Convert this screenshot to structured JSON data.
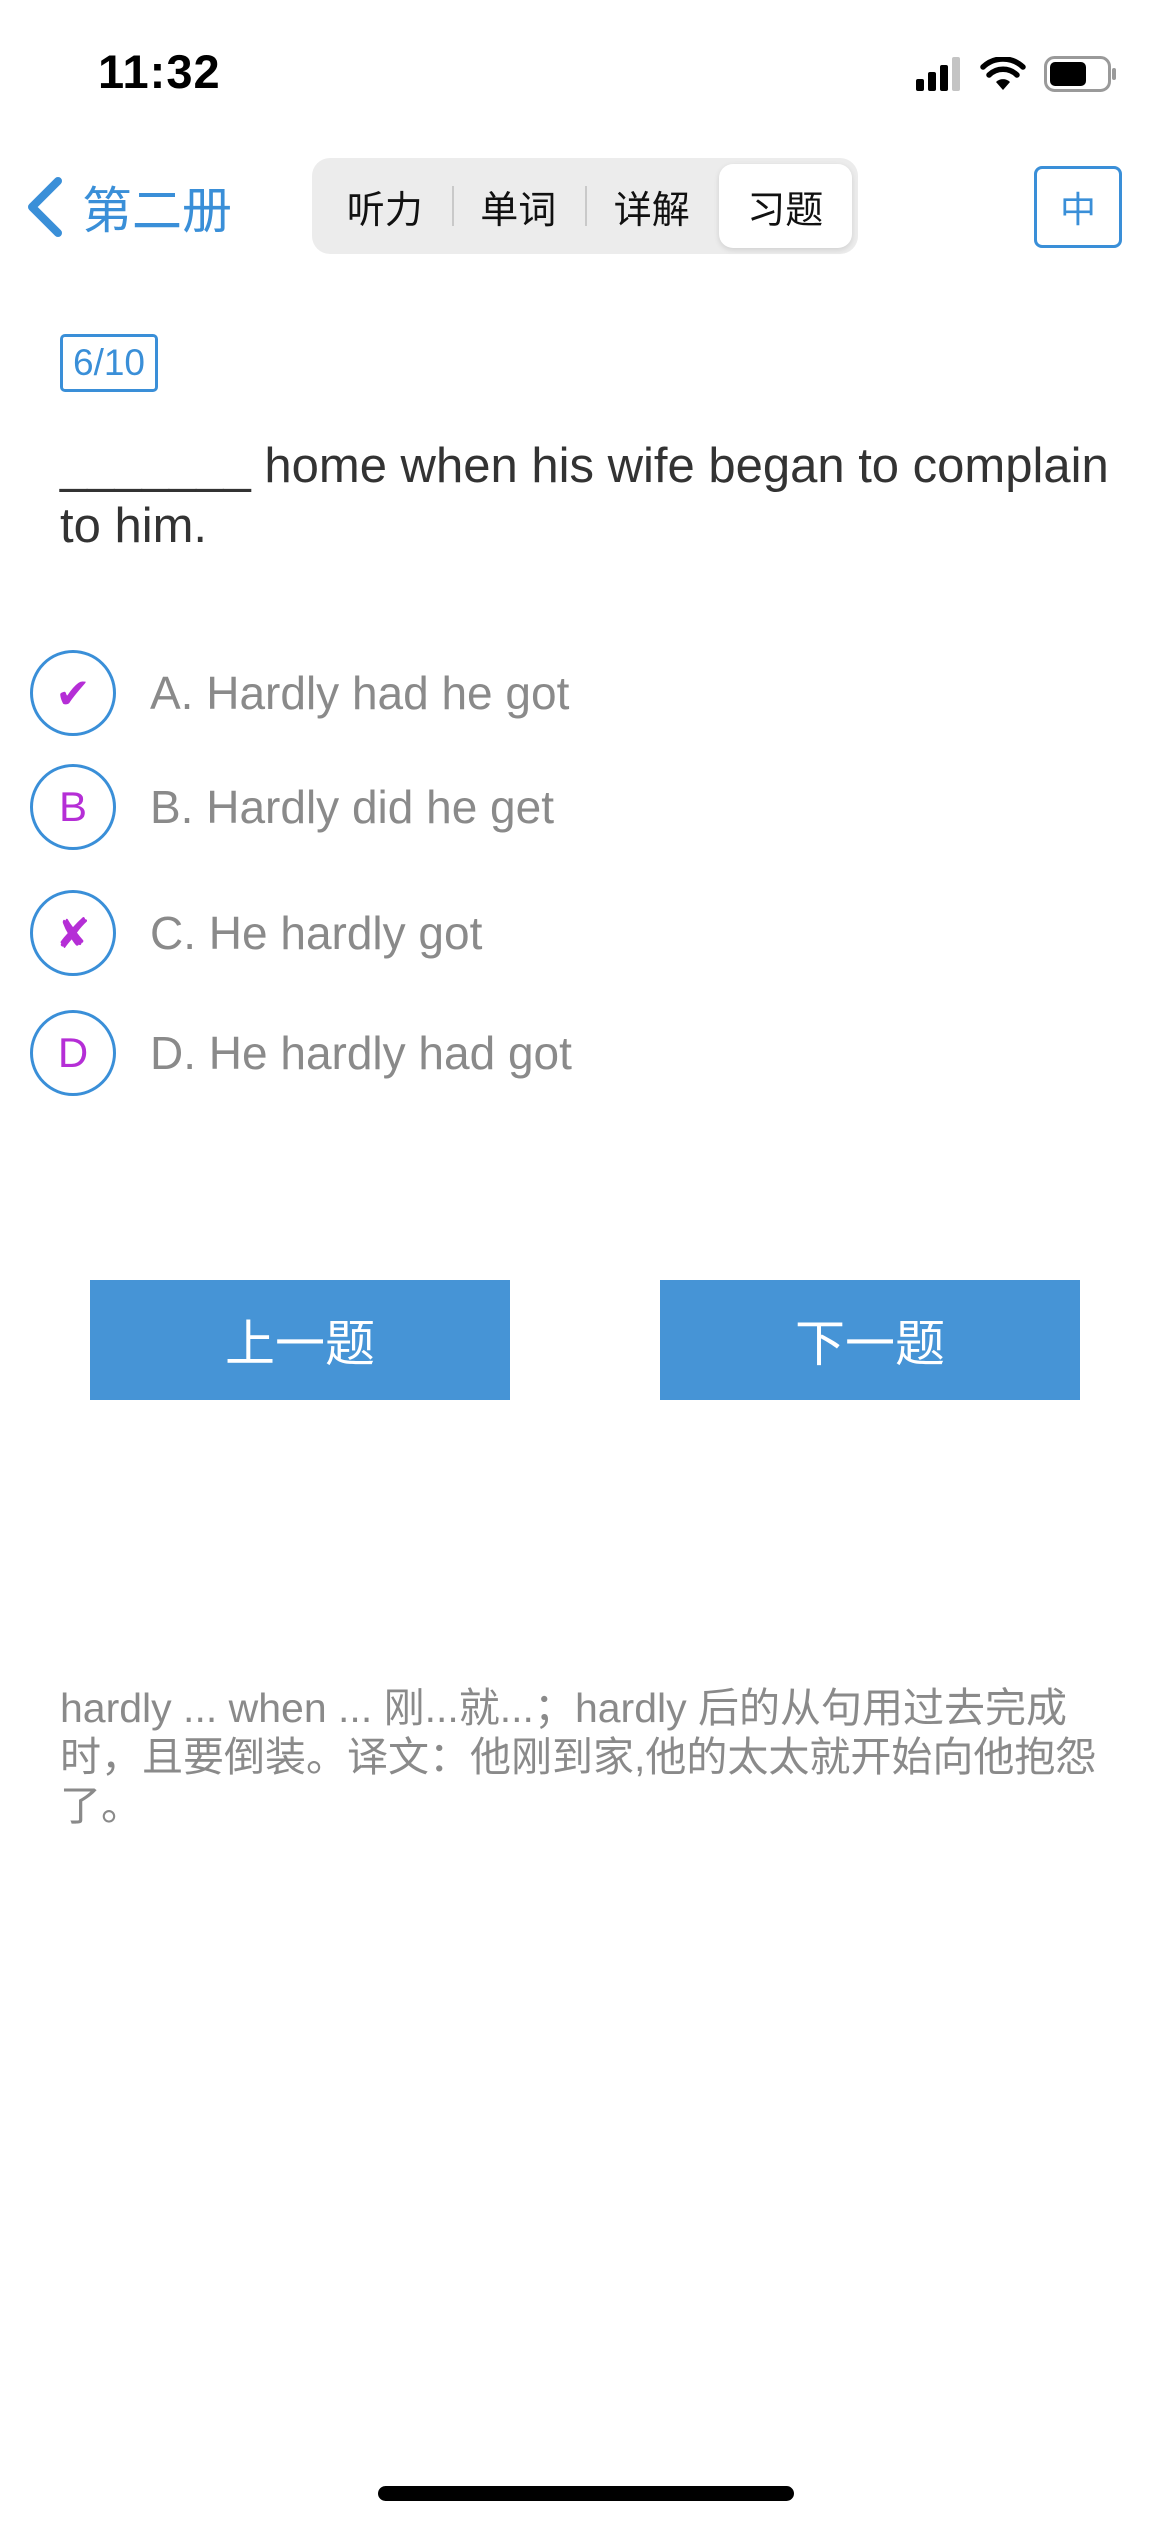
{
  "status_bar": {
    "time": "11:32",
    "icons": [
      "signal-icon",
      "wifi-icon",
      "battery-icon"
    ]
  },
  "nav": {
    "back_label": "第二册",
    "tabs": [
      {
        "label": "听力",
        "active": false
      },
      {
        "label": "单词",
        "active": false
      },
      {
        "label": "详解",
        "active": false
      },
      {
        "label": "习题",
        "active": true
      }
    ],
    "lang_button": "中"
  },
  "question": {
    "progress": "6/10",
    "text": "_______ home when his wife began to complain to him.",
    "options": [
      {
        "marker": "✔",
        "marker_icon": "check-icon",
        "text": "A. Hardly had he got",
        "state": "correct"
      },
      {
        "marker": "B",
        "marker_icon": "letter",
        "text": "B. Hardly did he get",
        "state": "none"
      },
      {
        "marker": "✘",
        "marker_icon": "cross-icon",
        "text": "C. He hardly got",
        "state": "wrong"
      },
      {
        "marker": "D",
        "marker_icon": "letter",
        "text": "D. He hardly had got",
        "state": "none"
      }
    ]
  },
  "buttons": {
    "prev": "上一题",
    "next": "下一题"
  },
  "explanation": "hardly ... when ... 刚...就...；hardly 后的从句用过去完成时，且要倒装。译文：他刚到家,他的太太就开始向他抱怨了。",
  "colors": {
    "accent": "#3a8fd8",
    "button": "#4694d6",
    "marker": "#b52ed6",
    "muted_text": "#8a8a8a"
  }
}
